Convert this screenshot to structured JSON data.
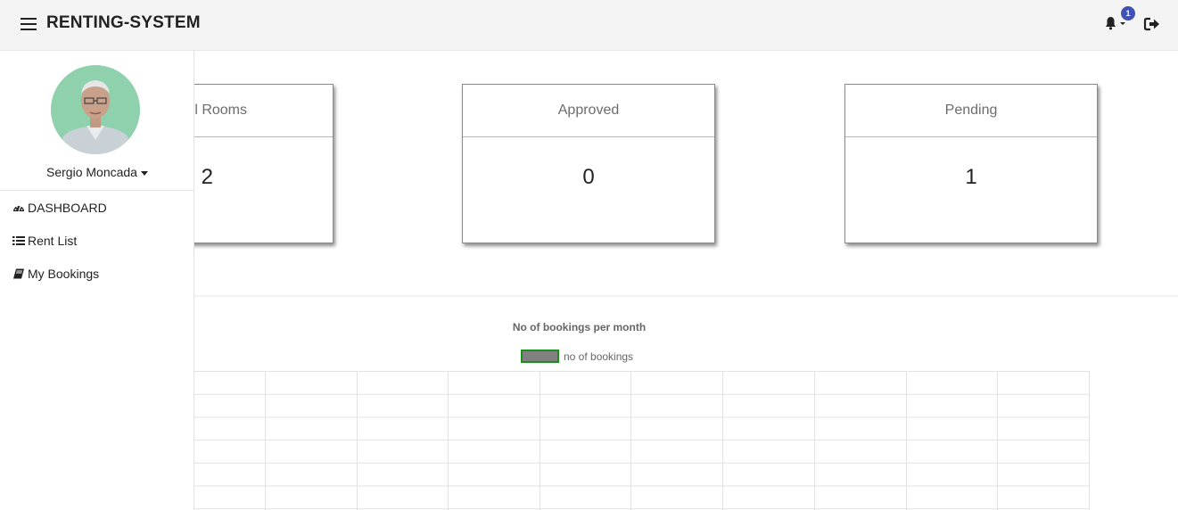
{
  "app": {
    "title": "RENTING-SYSTEM"
  },
  "header": {
    "notification_count": "1"
  },
  "user": {
    "name": "Sergio Moncada"
  },
  "sidebar": {
    "items": [
      {
        "label": "DASHBOARD",
        "icon": "dashboard-icon"
      },
      {
        "label": "Rent List",
        "icon": "list-icon"
      },
      {
        "label": "My Bookings",
        "icon": "book-icon"
      }
    ]
  },
  "cards": [
    {
      "title": "l Rooms",
      "value": "2"
    },
    {
      "title": "Approved",
      "value": "0"
    },
    {
      "title": "Pending",
      "value": "1"
    }
  ],
  "chart_data": {
    "type": "bar",
    "title": "No of bookings per month",
    "series": [
      {
        "name": "no of bookings",
        "values": []
      }
    ],
    "categories": [],
    "grid": true,
    "legend": "top-center",
    "colors": {
      "fill": "#808080",
      "border": "#1a8f1a"
    }
  }
}
